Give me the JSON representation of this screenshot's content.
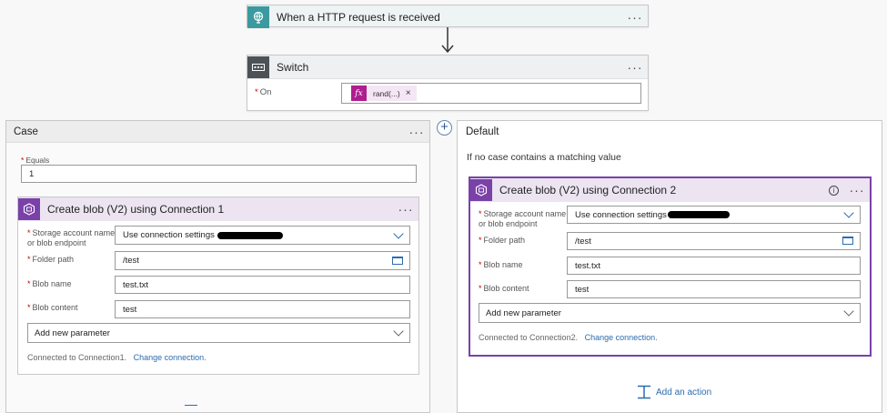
{
  "trigger": {
    "title": "When a HTTP request is received",
    "menu": "···"
  },
  "switch": {
    "title": "Switch",
    "menu": "···",
    "on_label": "On",
    "required": "*",
    "token_label": "rand(...)",
    "token_icon": "fx",
    "token_remove": "×"
  },
  "add_case": {
    "label": "+"
  },
  "case": {
    "title": "Case",
    "menu": "···",
    "equals_label": "Equals",
    "equals_value": "1",
    "action": {
      "title": "Create blob (V2) using Connection 1",
      "menu": "···",
      "storage_label_1": "Storage account name",
      "storage_label_2": "or blob endpoint",
      "storage_value": "Use connection settings",
      "folder_label": "Folder path",
      "folder_value": "/test",
      "blob_name_label": "Blob name",
      "blob_name_value": "test.txt",
      "blob_content_label": "Blob content",
      "blob_content_value": "test",
      "add_param": "Add new parameter",
      "connected": "Connected to Connection1.",
      "change": "Change connection."
    }
  },
  "default": {
    "title": "Default",
    "note": "If no case contains a matching value",
    "action": {
      "title": "Create blob (V2) using Connection 2",
      "info": "i",
      "menu": "···",
      "storage_label_1": "Storage account name",
      "storage_label_2": "or blob endpoint",
      "storage_value": "Use connection settings",
      "folder_label": "Folder path",
      "folder_value": "/test",
      "blob_name_label": "Blob name",
      "blob_name_value": "test.txt",
      "blob_content_label": "Blob content",
      "blob_content_value": "test",
      "add_param": "Add new parameter",
      "connected": "Connected to Connection2.",
      "change": "Change connection."
    },
    "add_action": "Add an action"
  },
  "colors": {
    "http_teal": "#3b9a9f",
    "switch_gray": "#4b5358",
    "blob_purple": "#7a41a8",
    "link_blue": "#2b6cb0",
    "fx_magenta": "#ad1f8f"
  }
}
